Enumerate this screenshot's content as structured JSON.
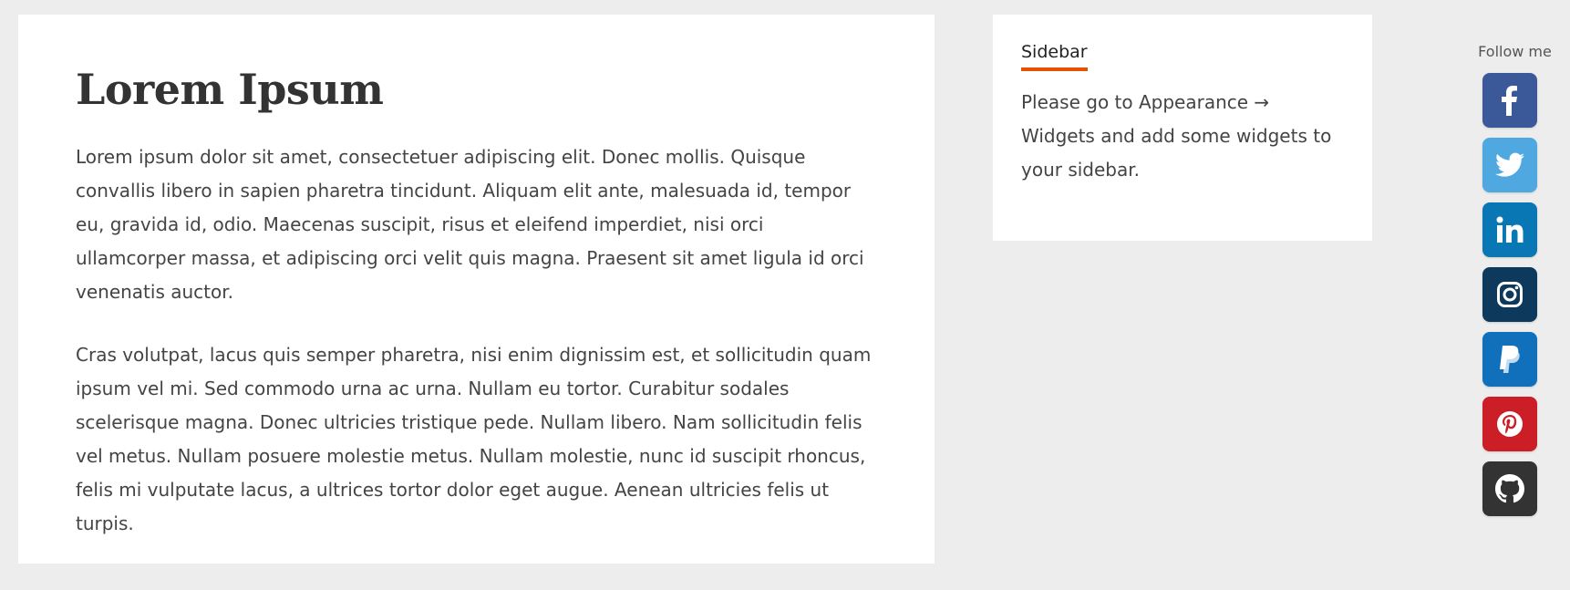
{
  "article": {
    "title": "Lorem Ipsum",
    "paragraphs": [
      "Lorem ipsum dolor sit amet, consectetuer adipiscing elit. Donec mollis. Quisque convallis libero in sapien pharetra tincidunt. Aliquam elit ante, malesuada id, tempor eu, gravida id, odio. Maecenas suscipit, risus et eleifend imperdiet, nisi orci ullamcorper massa, et adipiscing orci velit quis magna. Praesent sit amet ligula id orci venenatis auctor.",
      "Cras volutpat, lacus quis semper pharetra, nisi enim dignissim est, et sollicitudin quam ipsum vel mi. Sed commodo urna ac urna. Nullam eu tortor. Curabitur sodales scelerisque magna. Donec ultricies tristique pede. Nullam libero. Nam sollicitudin felis vel metus. Nullam posuere molestie metus. Nullam molestie, nunc id suscipit rhoncus, felis mi vulputate lacus, a ultrices tortor dolor eget augue. Aenean ultricies felis ut turpis."
    ]
  },
  "sidebar": {
    "title": "Sidebar",
    "text": "Please go to Appearance → Widgets and add some widgets to your sidebar.",
    "accent_color": "#e65100"
  },
  "social": {
    "label": "Follow me",
    "buttons": [
      {
        "icon": "facebook-icon",
        "color": "#3b5998"
      },
      {
        "icon": "twitter-icon",
        "color": "#4fa9e0"
      },
      {
        "icon": "linkedin-icon",
        "color": "#0a77b5"
      },
      {
        "icon": "instagram-icon",
        "color": "#0d3a5c"
      },
      {
        "icon": "paypal-icon",
        "color": "#1070bb"
      },
      {
        "icon": "pinterest-icon",
        "color": "#cc1e26"
      },
      {
        "icon": "github-icon",
        "color": "#333333"
      }
    ]
  }
}
